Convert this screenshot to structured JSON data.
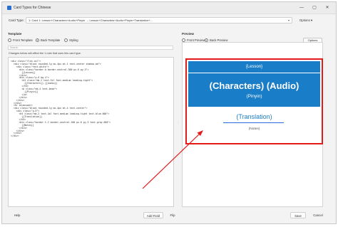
{
  "window": {
    "title": "Card Types for Chinese"
  },
  "window_controls": {
    "minimize": "—",
    "maximize": "▢",
    "close": "✕"
  },
  "card_type": {
    "label": "Card Type:",
    "value": "1: Card 1: Lesson+Characters+Audio+Pinyin → Lesson+Characters+Audio+Pinyin+Translation+...",
    "options_label": "Options ▾"
  },
  "template": {
    "title": "Template",
    "front_label": "Front Template",
    "back_label": "Back Template",
    "styling_label": "Styling",
    "selected": "back",
    "search_placeholder": "Search",
    "notice": "Changes below will affect the 1 note that uses this card type.",
    "code_lines": [
      "<div class=\"flex-col\">",
      "  <div class=\"block rounded-lg mx-4px mt-1 text-center shadow-md\">",
      "    <div class=\"text-white\">",
      "      <div class=\"border-b border-neutral-300 px-6 py-3\">",
      "        {{Lesson}}",
      "      </div>",
      "      <div class=\"p-6 bg-4\">",
      "        <h5 class=\"mb-2 text-5xl font-medium leading-tight\">",
      "          {{Characters}} {{Audio}}",
      "        </h5>",
      "        <p class=\"mb-4 text-base\">",
      "          {{Pinyin}}",
      "        </p>",
      "      </div>",
      "    </div>",
      "  </div>",
      "  <hr id=answer>",
      "  <div class=\"block rounded-lg mx-4px mt-4 text-center\">",
      "    <div class=\"p-6\">",
      "      <h5 class=\"mb-2 text-4xl font-medium leading-tight text-blue-600\">",
      "        {{Translation}}",
      "      </h5>",
      "      <div class=\"border-t-2 border-neutral-100 px-6 py-3 text-gray-600\">",
      "        {{Notes}}",
      "      </div>",
      "    </div>",
      "  </div>",
      "</div>"
    ]
  },
  "splitter": {
    "glyph": "⋮"
  },
  "preview": {
    "title": "Preview",
    "front_label": "Front Preview",
    "back_label": "Back Preview",
    "selected": "back",
    "options_label": "Options",
    "card": {
      "lesson": "{Lesson}",
      "characters": "(Characters) (Audio)",
      "pinyin": "(Pinyin)",
      "translation": "(Translation)",
      "notes": "(Notes)"
    }
  },
  "bottom": {
    "help": "Help",
    "add_field": "Add Field",
    "flip": "Flip",
    "save": "Save",
    "cancel": "Cancel"
  },
  "colors": {
    "card_blue": "#1a7dc7",
    "highlight_red": "#e31b1b"
  }
}
